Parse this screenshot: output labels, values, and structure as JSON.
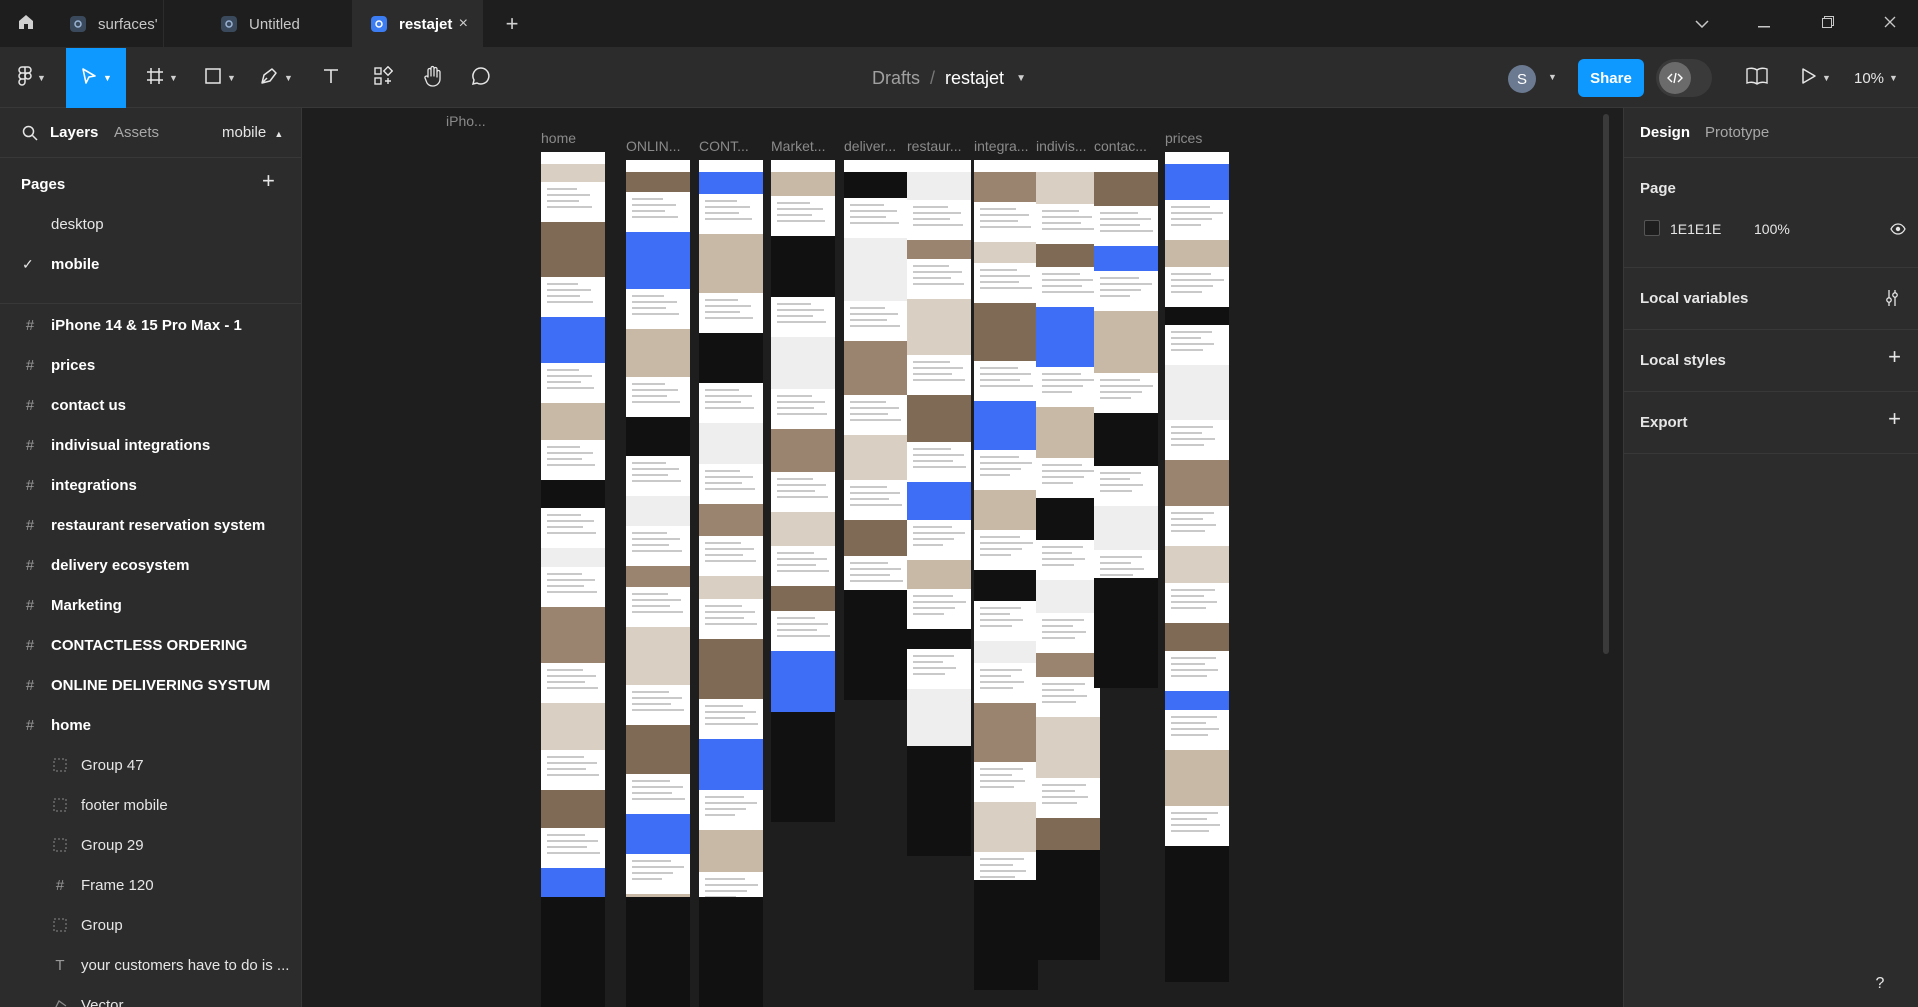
{
  "tabs": [
    {
      "label": "surfaces'",
      "active": false
    },
    {
      "label": "Untitled",
      "active": false
    },
    {
      "label": "restajet",
      "active": true
    }
  ],
  "tab_close": "×",
  "new_tab": "+",
  "breadcrumb": {
    "drafts": "Drafts",
    "sep": "/",
    "file": "restajet"
  },
  "avatar_initial": "S",
  "share_label": "Share",
  "zoom_label": "10%",
  "left_panel": {
    "layers_tab": "Layers",
    "assets_tab": "Assets",
    "current_page": "mobile",
    "pages_header": "Pages",
    "pages": [
      {
        "label": "desktop",
        "checked": false
      },
      {
        "label": "mobile",
        "checked": true
      }
    ],
    "layers": [
      {
        "label": "iPhone 14 & 15 Pro Max - 1",
        "kind": "frame",
        "depth": 0
      },
      {
        "label": "prices",
        "kind": "frame",
        "depth": 0
      },
      {
        "label": "contact us",
        "kind": "frame",
        "depth": 0
      },
      {
        "label": "indivisual integrations",
        "kind": "frame",
        "depth": 0
      },
      {
        "label": "integrations",
        "kind": "frame",
        "depth": 0
      },
      {
        "label": "restaurant reservation system",
        "kind": "frame",
        "depth": 0
      },
      {
        "label": "delivery ecosystem",
        "kind": "frame",
        "depth": 0
      },
      {
        "label": "Marketing",
        "kind": "frame",
        "depth": 0
      },
      {
        "label": "CONTACTLESS ORDERING",
        "kind": "frame",
        "depth": 0
      },
      {
        "label": "ONLINE DELIVERING SYSTUM",
        "kind": "frame",
        "depth": 0
      },
      {
        "label": "home",
        "kind": "frame",
        "depth": 0
      },
      {
        "label": "Group 47",
        "kind": "group",
        "depth": 1
      },
      {
        "label": "footer mobile",
        "kind": "group",
        "depth": 1
      },
      {
        "label": "Group 29",
        "kind": "group",
        "depth": 1
      },
      {
        "label": "Frame 120",
        "kind": "frame",
        "depth": 1
      },
      {
        "label": "Group",
        "kind": "group",
        "depth": 1
      },
      {
        "label": "your customers have to do is ...",
        "kind": "text",
        "depth": 1
      },
      {
        "label": "Vector",
        "kind": "vector",
        "depth": 1
      }
    ]
  },
  "canvas": {
    "top_label": "iPho...",
    "frames": [
      {
        "label": "home"
      },
      {
        "label": "ONLIN..."
      },
      {
        "label": "CONT..."
      },
      {
        "label": "Market..."
      },
      {
        "label": "deliver..."
      },
      {
        "label": "restaur..."
      },
      {
        "label": "integra..."
      },
      {
        "label": "indivis..."
      },
      {
        "label": "contac..."
      },
      {
        "label": "prices"
      }
    ]
  },
  "right_panel": {
    "design_tab": "Design",
    "prototype_tab": "Prototype",
    "page_section": "Page",
    "page_bg_hex": "1E1E1E",
    "page_bg_opacity": "100%",
    "local_variables": "Local variables",
    "local_styles": "Local styles",
    "export": "Export"
  },
  "help_label": "?",
  "colors": {
    "accent": "#0d99ff",
    "bg": "#1e1e1e",
    "panel": "#2c2c2c",
    "brand_blue": "#3d6ef5"
  }
}
